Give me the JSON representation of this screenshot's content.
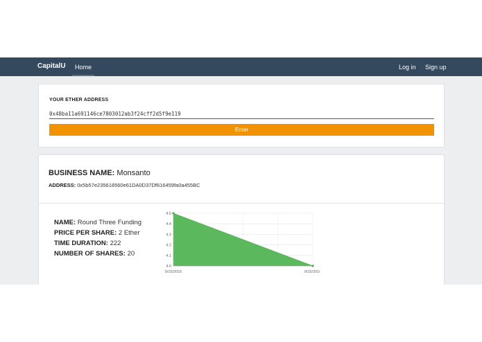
{
  "navbar": {
    "brand": "CapitalU",
    "home": "Home",
    "login": "Log in",
    "signup": "Sign up"
  },
  "address_form": {
    "label": "YOUR ETHER ADDRESS",
    "value": "0x48ba11a691146ce7803012ab3f24cff2d5f9e119",
    "button": "Enter"
  },
  "business": {
    "name_label": "BUSINESS NAME:",
    "name": "Monsanto",
    "address_label": "ADDRESS:",
    "address": "0x5b57e235618560e61DA0D37Df616459fa0a455BC"
  },
  "offering": {
    "name_label": "NAME:",
    "name": "Round Three Funding",
    "price_label": "PRICE PER SHARE:",
    "price": "2 Ether",
    "duration_label": "TIME DURATION:",
    "duration": "222",
    "shares_label": "NUMBER OF SHARES:",
    "shares": "20"
  },
  "colors": {
    "navbar": "#34495e",
    "button": "#f39200",
    "chart_fill": "#5cb85c"
  },
  "chart_data": {
    "type": "area",
    "x": [
      "9/15/2016",
      "9/15/2016"
    ],
    "y": [
      4.5,
      4.0
    ],
    "ylim": [
      4.0,
      4.5
    ],
    "yticks": [
      "4.0",
      "4.1",
      "4.2",
      "4.3",
      "4.4",
      "4.5"
    ],
    "xticks": [
      "9/15/2016",
      "9/15/2016"
    ],
    "grid": true
  }
}
